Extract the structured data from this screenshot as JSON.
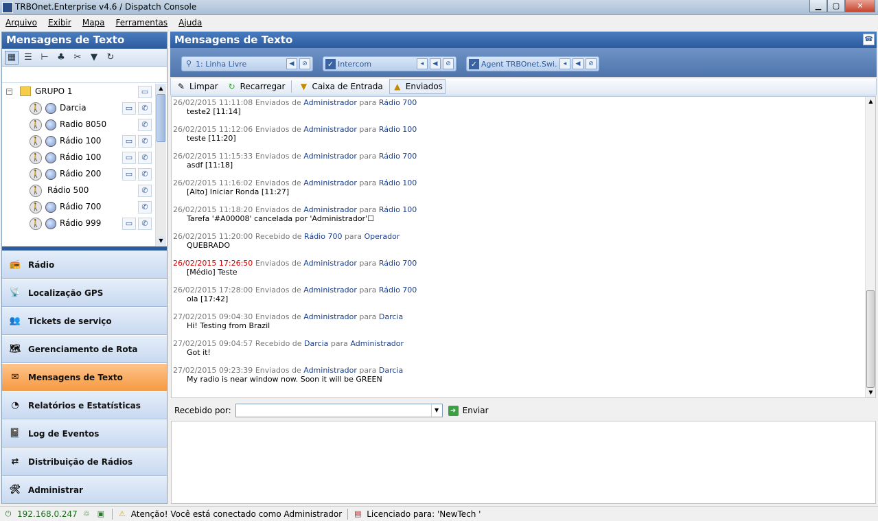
{
  "window": {
    "title": "TRBOnet.Enterprise v4.6 / Dispatch Console"
  },
  "menu": [
    "Arquivo",
    "Exibir",
    "Mapa",
    "Ferramentas",
    "Ajuda"
  ],
  "left_panel": {
    "title": "Mensagens de Texto",
    "group": {
      "label": "GRUPO 1"
    },
    "radios": [
      {
        "name": "Darcia",
        "has_message": true,
        "has_globe": true
      },
      {
        "name": "Radio 8050",
        "has_message": false,
        "has_globe": true
      },
      {
        "name": "Rádio 100",
        "has_message": true,
        "has_globe": true
      },
      {
        "name": "Rádio 100",
        "has_message": true,
        "has_globe": true
      },
      {
        "name": "Rádio 200",
        "has_message": true,
        "has_globe": true
      },
      {
        "name": "Rádio 500",
        "has_message": false,
        "has_globe": false
      },
      {
        "name": "Rádio 700",
        "has_message": false,
        "has_globe": true
      },
      {
        "name": "Rádio 999",
        "has_message": true,
        "has_globe": true
      }
    ]
  },
  "nav": [
    {
      "label": "Rádio",
      "icon": "radio-icon",
      "active": false
    },
    {
      "label": "Localização GPS",
      "icon": "gps-icon",
      "active": false
    },
    {
      "label": "Tickets de serviço",
      "icon": "tickets-icon",
      "active": false
    },
    {
      "label": "Gerenciamento de Rota",
      "icon": "route-icon",
      "active": false
    },
    {
      "label": "Mensagens de Texto",
      "icon": "envelope-icon",
      "active": true
    },
    {
      "label": "Relatórios e Estatísticas",
      "icon": "reports-icon",
      "active": false
    },
    {
      "label": "Log de Eventos",
      "icon": "log-icon",
      "active": false
    },
    {
      "label": "Distribuição de Rádios",
      "icon": "distribution-icon",
      "active": false
    },
    {
      "label": "Administrar",
      "icon": "admin-icon",
      "active": false
    }
  ],
  "main": {
    "title": "Mensagens de Texto",
    "channels": [
      {
        "label": "1: Linha Livre",
        "checked": false
      },
      {
        "label": "Intercom",
        "checked": true
      },
      {
        "label": "Agent TRBOnet.Swi...",
        "checked": true
      }
    ],
    "toolbar": {
      "clear": "Limpar",
      "reload": "Recarregar",
      "inbox": "Caixa de Entrada",
      "sent": "Enviados"
    },
    "messages": [
      {
        "ts": "26/02/2015 11:11:08",
        "ts_red": false,
        "kind": "Enviados de",
        "from": "Administrador",
        "to": "Rádio 700",
        "text": "teste2 [11:14]"
      },
      {
        "ts": "26/02/2015 11:12:06",
        "ts_red": false,
        "kind": "Enviados de",
        "from": "Administrador",
        "to": "Rádio 100",
        "text": "teste [11:20]"
      },
      {
        "ts": "26/02/2015 11:15:33",
        "ts_red": false,
        "kind": "Enviados de",
        "from": "Administrador",
        "to": "Rádio 700",
        "text": "asdf [11:18]"
      },
      {
        "ts": "26/02/2015 11:16:02",
        "ts_red": false,
        "kind": "Enviados de",
        "from": "Administrador",
        "to": "Rádio 100",
        "text": "[Alto] Iniciar Ronda [11:27]"
      },
      {
        "ts": "26/02/2015 11:18:20",
        "ts_red": false,
        "kind": "Enviados de",
        "from": "Administrador",
        "to": "Rádio 100",
        "text": "Tarefa '#A00008' cancelada por 'Administrador'☐"
      },
      {
        "ts": "26/02/2015 11:20:00",
        "ts_red": false,
        "kind": "Recebido de",
        "from": "Rádio 700",
        "to": "Operador",
        "text": "QUEBRADO"
      },
      {
        "ts": "26/02/2015 17:26:50",
        "ts_red": true,
        "kind": "Enviados de",
        "from": "Administrador",
        "to": "Rádio 700",
        "text": "[Médio] Teste"
      },
      {
        "ts": "26/02/2015 17:28:00",
        "ts_red": false,
        "kind": "Enviados de",
        "from": "Administrador",
        "to": "Rádio 700",
        "text": "ola [17:42]"
      },
      {
        "ts": "27/02/2015 09:04:30",
        "ts_red": false,
        "kind": "Enviados de",
        "from": "Administrador",
        "to": "Darcia",
        "text": "Hi! Testing from Brazil"
      },
      {
        "ts": "27/02/2015 09:04:57",
        "ts_red": false,
        "kind": "Recebido de",
        "from": "Darcia",
        "to": "Administrador",
        "text": "Got it!"
      },
      {
        "ts": "27/02/2015 09:23:39",
        "ts_red": false,
        "kind": "Enviados de",
        "from": "Administrador",
        "to": "Darcia",
        "text": "My radio is near window now. Soon it will be GREEN"
      }
    ],
    "para": "para",
    "send": {
      "received_by_label": "Recebido por:",
      "received_by_value": "",
      "send_label": "Enviar"
    }
  },
  "status": {
    "ip": "192.168.0.247",
    "warning": "Atenção! Você está conectado como Administrador",
    "license": "Licenciado para: 'NewTech '"
  }
}
